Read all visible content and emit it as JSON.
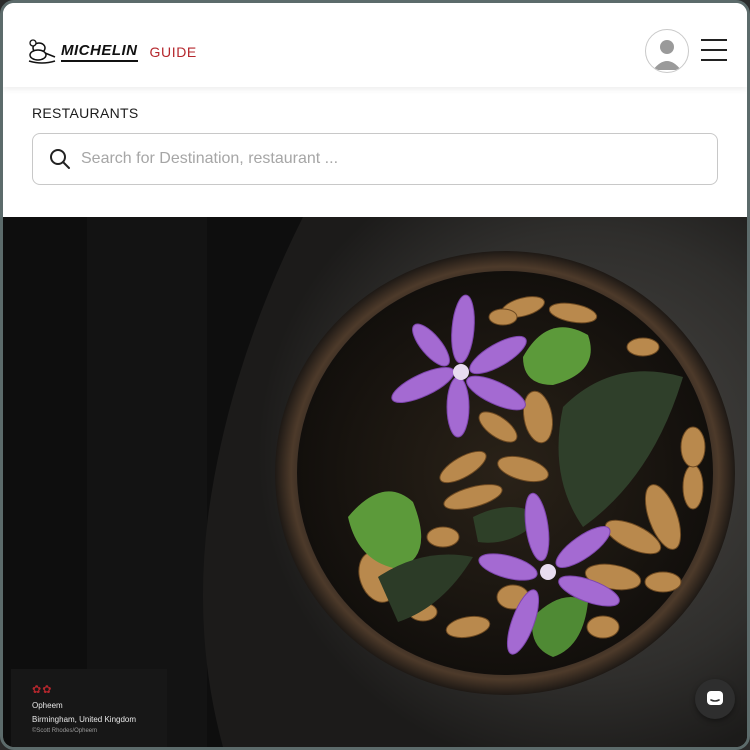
{
  "header": {
    "brand": "MICHELIN",
    "guide_label": "GUIDE",
    "brand_color": "#b5272d",
    "avatar_icon": "user-icon",
    "menu_icon": "hamburger-icon"
  },
  "search": {
    "section_title": "RESTAURANTS",
    "placeholder": "Search for Destination, restaurant ...",
    "value": ""
  },
  "hero": {
    "stars": "✿✿",
    "restaurant_name": "Opheem",
    "location": "Birmingham, United Kingdom",
    "credit": "©Scott Rhodes/Opheem",
    "chat_icon": "chat-icon"
  }
}
